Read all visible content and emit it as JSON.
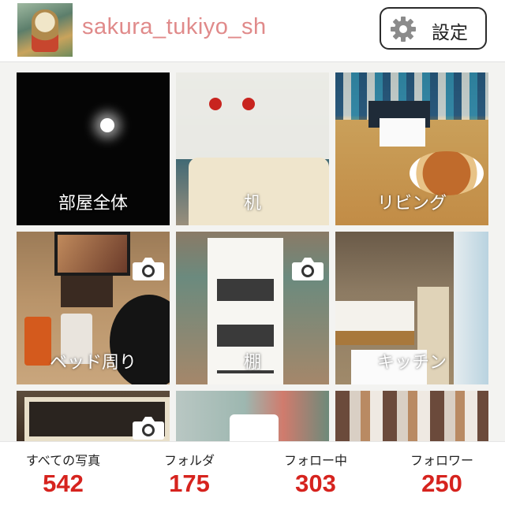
{
  "header": {
    "username": "sakura_tukiyo_sh",
    "settings_label": "設定",
    "settings_icon": "gear-icon"
  },
  "folders": [
    {
      "label": "部屋全体",
      "camera_icon": false
    },
    {
      "label": "机",
      "camera_icon": false
    },
    {
      "label": "リビング",
      "camera_icon": false
    },
    {
      "label": "ベッド周り",
      "camera_icon": true
    },
    {
      "label": "棚",
      "camera_icon": true
    },
    {
      "label": "キッチン",
      "camera_icon": false
    },
    {
      "label": "",
      "camera_icon": true
    },
    {
      "label": "",
      "camera_icon": false
    },
    {
      "label": "",
      "camera_icon": false
    }
  ],
  "stats": [
    {
      "label": "すべての写真",
      "value": "542"
    },
    {
      "label": "フォルダ",
      "value": "175"
    },
    {
      "label": "フォロー中",
      "value": "303"
    },
    {
      "label": "フォロワー",
      "value": "250"
    }
  ],
  "colors": {
    "username": "#e08a8a",
    "stat_number": "#d6231e",
    "button_border": "#2b2b2b"
  }
}
